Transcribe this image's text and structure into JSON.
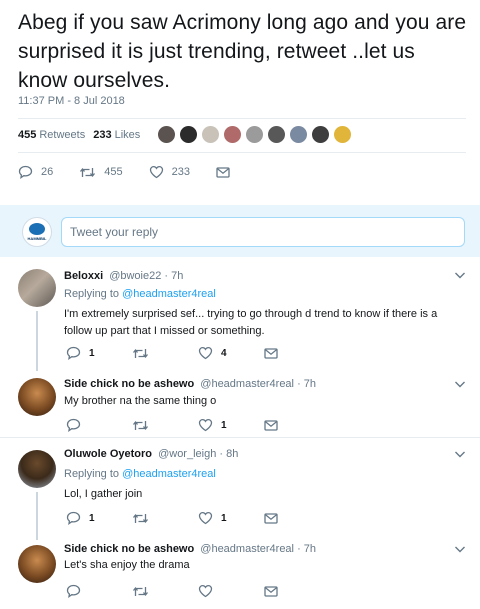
{
  "tweet": {
    "text": "Abeg if you saw Acrimony long ago and you are surprised it is just trending, retweet ..let us know ourselves.",
    "timestamp": "11:37 PM - 8 Jul 2018",
    "retweets_count": "455",
    "retweets_label": "Retweets",
    "likes_count": "233",
    "likes_label": "Likes",
    "actions": {
      "replies": "26",
      "retweets": "455",
      "likes": "233"
    }
  },
  "reply_box": {
    "placeholder": "Tweet your reply",
    "avatar_brand": "HAMMBIL"
  },
  "replies": [
    {
      "name": "Beloxxi",
      "handle": "@bwoie22",
      "time": "· 7h",
      "replying_prefix": "Replying to",
      "replying_to": "@headmaster4real",
      "text": "I'm extremely surprised sef... trying to go through d trend to know if there is a follow up part that I missed or something.",
      "replies": "1",
      "retweets": "",
      "likes": "4"
    },
    {
      "name": "Side chick no be ashewo",
      "handle": "@headmaster4real",
      "time": "· 7h",
      "text": "My brother na the same thing o",
      "replies": "",
      "retweets": "",
      "likes": "1"
    },
    {
      "name": "Oluwole Oyetoro",
      "handle": "@wor_leigh",
      "time": "· 8h",
      "replying_prefix": "Replying to",
      "replying_to": "@headmaster4real",
      "text": "Lol, I gather join",
      "replies": "1",
      "retweets": "",
      "likes": "1"
    },
    {
      "name": "Side chick no be ashewo",
      "handle": "@headmaster4real",
      "time": "· 7h",
      "text": "Let's sha enjoy the drama",
      "replies": "",
      "retweets": "",
      "likes": ""
    }
  ],
  "colors": {
    "accent": "#1da1f2",
    "muted": "#657786",
    "reply_band": "#e8f5fd"
  }
}
